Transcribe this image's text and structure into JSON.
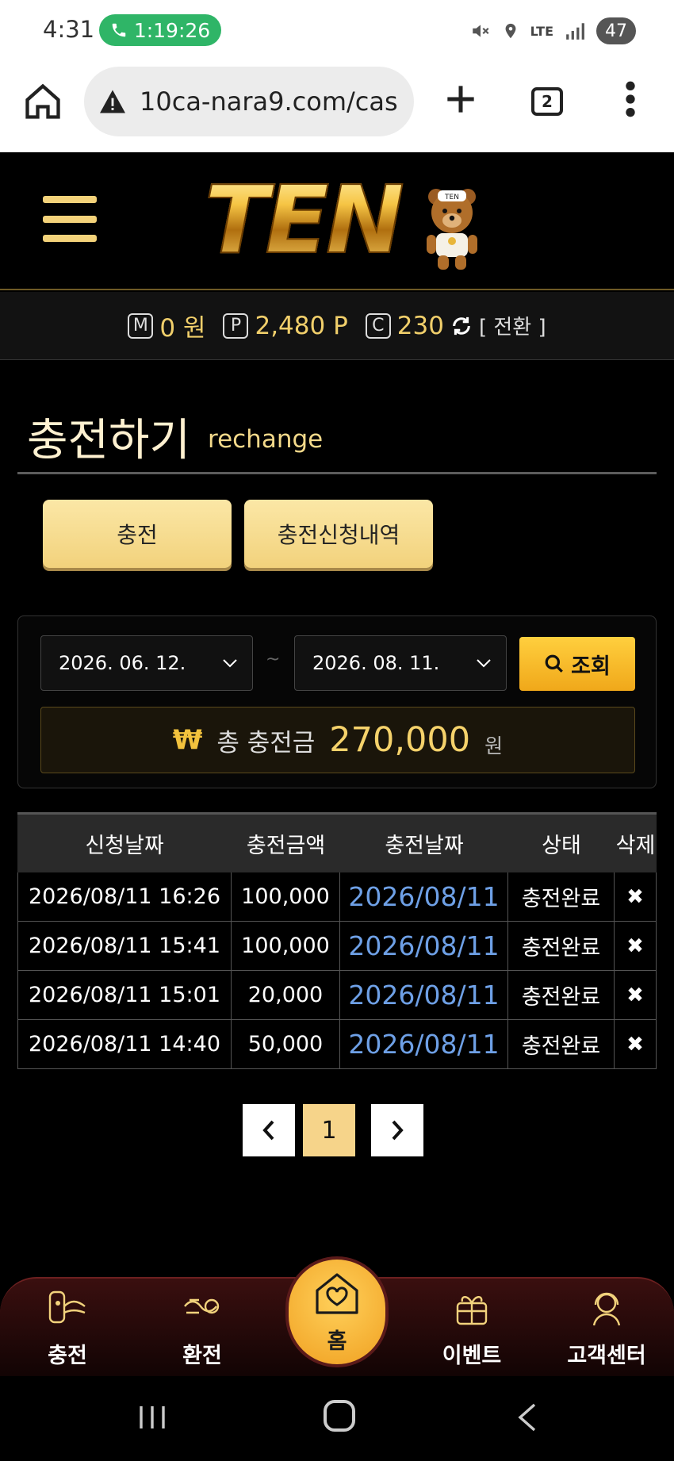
{
  "status_bar": {
    "time": "4:31",
    "call_timer": "1:19:26",
    "network": "LTE",
    "battery": "47"
  },
  "browser": {
    "url": "10ca-nara9.com/cas",
    "tab_count": "2"
  },
  "header": {
    "logo_text": "TEN",
    "mascot_text": "TEN"
  },
  "balance": {
    "money_badge": "M",
    "money_value": "0 원",
    "point_badge": "P",
    "point_value": "2,480 P",
    "coin_badge": "C",
    "coin_value": "230",
    "switch_label": "[ 전환 ]"
  },
  "page": {
    "title": "충전하기",
    "subtitle": "rechange"
  },
  "tabs": [
    {
      "label": "충전"
    },
    {
      "label": "충전신청내역"
    }
  ],
  "filter": {
    "date_from": "2026. 06. 12.",
    "separator": "~",
    "date_to": "2026. 08. 11.",
    "search_label": "조회",
    "currency_symbol": "₩",
    "total_label": "총 충전금",
    "total_value": "270,000",
    "total_unit": "원"
  },
  "table": {
    "headers": [
      "신청날짜",
      "충전금액",
      "충전날짜",
      "상태",
      "삭제"
    ],
    "rows": [
      [
        "2026/08/11 16:26",
        "100,000",
        "2026/08/11",
        "충전완료",
        "✖"
      ],
      [
        "2026/08/11 15:41",
        "100,000",
        "2026/08/11",
        "충전완료",
        "✖"
      ],
      [
        "2026/08/11 15:01",
        "20,000",
        "2026/08/11",
        "충전완료",
        "✖"
      ],
      [
        "2026/08/11 14:40",
        "50,000",
        "2026/08/11",
        "충전완료",
        "✖"
      ]
    ]
  },
  "pagination": {
    "current_page": "1"
  },
  "bottom_nav": {
    "charge": "충전",
    "exchange": "환전",
    "home": "홈",
    "event": "이벤트",
    "support": "고객센터"
  },
  "colors": {
    "accent_gold": "#f2d27c",
    "link_blue": "#6ea0e6",
    "call_green": "#2fb567"
  }
}
